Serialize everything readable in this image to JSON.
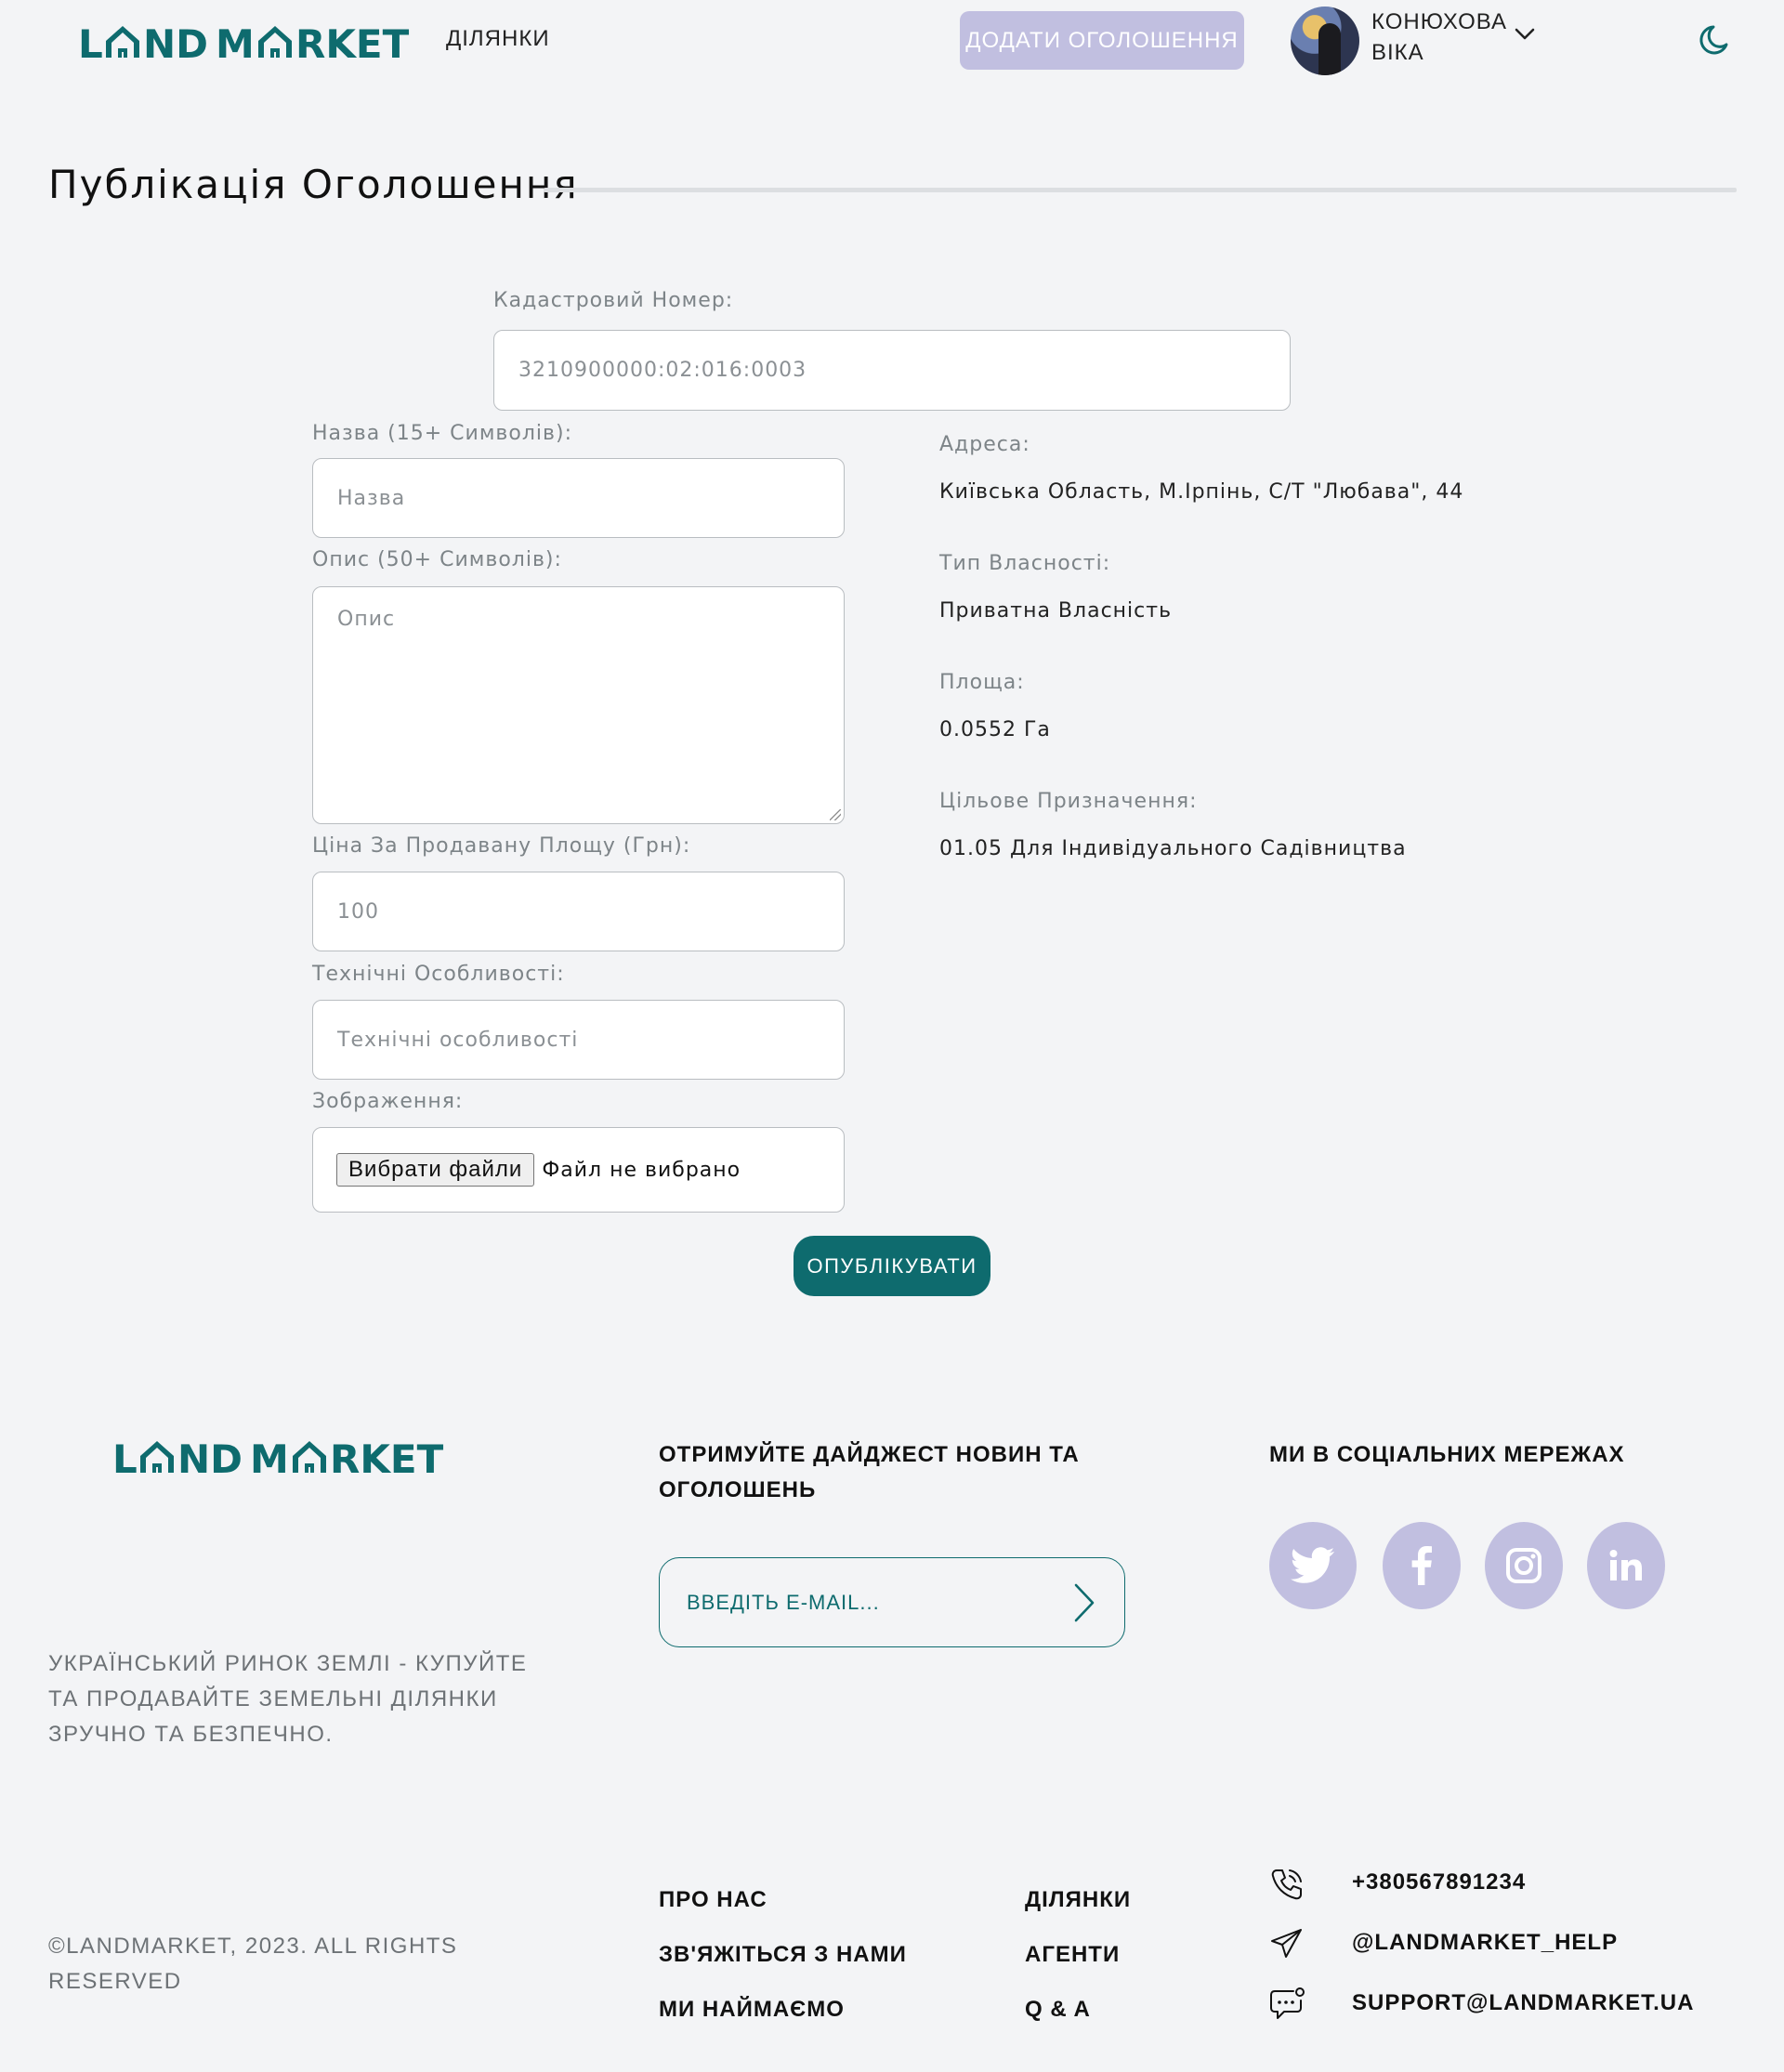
{
  "header": {
    "logo": "LAND MARKET",
    "nav_plots": "ДІЛЯНКИ",
    "add_listing": "ДОДАТИ ОГОЛОШЕННЯ",
    "user_name_line1": "КОНЮХОВА",
    "user_name_line2": "ВІКА"
  },
  "page": {
    "title": "Публікація Оголошення"
  },
  "form": {
    "cadastral_label": "Кадастровий Номер:",
    "cadastral_value": "3210900000:02:016:0003",
    "name_label": "Назва (15+ Символів):",
    "name_placeholder": "Назва",
    "description_label": "Опис (50+ Символів):",
    "description_placeholder": "Опис",
    "price_label": "Ціна За Продавану Площу (Грн):",
    "price_placeholder": "100",
    "tech_label": "Технічні Особливості:",
    "tech_placeholder": "Технічні особливості",
    "images_label": "Зображення:",
    "file_button": "Вибрати файли",
    "file_status": "Файл не вибрано",
    "publish": "ОПУБЛІКУВАТИ"
  },
  "info": {
    "address_label": "Адреса:",
    "address_value": "Київська Область, М.Ірпінь, С/Т \"Любава\", 44",
    "ownership_label": "Тип Власності:",
    "ownership_value": "Приватна Власність",
    "area_label": "Площа:",
    "area_value": "0.0552 Га",
    "purpose_label": "Цільове Призначення:",
    "purpose_value": "01.05 Для Індивідуального Садівництва"
  },
  "footer": {
    "logo": "LAND MARKET",
    "tagline_line1": "УКРАЇНСЬКИЙ РИНОК ЗЕМЛІ - КУПУЙТЕ",
    "tagline_line2": "ТА ПРОДАВАЙТЕ ЗЕМЕЛЬНІ ДІЛЯНКИ",
    "tagline_line3": "ЗРУЧНО ТА БЕЗПЕЧНО.",
    "digest_line1": "ОТРИМУЙТЕ ДАЙДЖЕСТ НОВИН ТА",
    "digest_line2": "ОГОЛОШЕНЬ",
    "email_placeholder": "ВВЕДІТЬ E-MAIL...",
    "social_heading": "МИ В СОЦІАЛЬНИХ МЕРЕЖАХ",
    "social_icons": [
      "twitter-icon",
      "facebook-icon",
      "instagram-icon",
      "linkedin-icon"
    ],
    "copyright_line1": "©LANDMARKET, 2023. ALL RIGHTS",
    "copyright_line2": "RESERVED",
    "links_col1": [
      "ПРО НАС",
      "ЗВ'ЯЖІТЬСЯ З НАМИ",
      "МИ НАЙМАЄМО"
    ],
    "links_col2": [
      "ДІЛЯНКИ",
      "АГЕНТИ",
      "Q & A"
    ],
    "phone": "+380567891234",
    "telegram": "@LANDMARKET_HELP",
    "email": "SUPPORT@LANDMARKET.UA"
  },
  "colors": {
    "brand": "#0e6b6e",
    "accent_lavender": "#c1bfe0",
    "background": "#f3f4f6"
  }
}
